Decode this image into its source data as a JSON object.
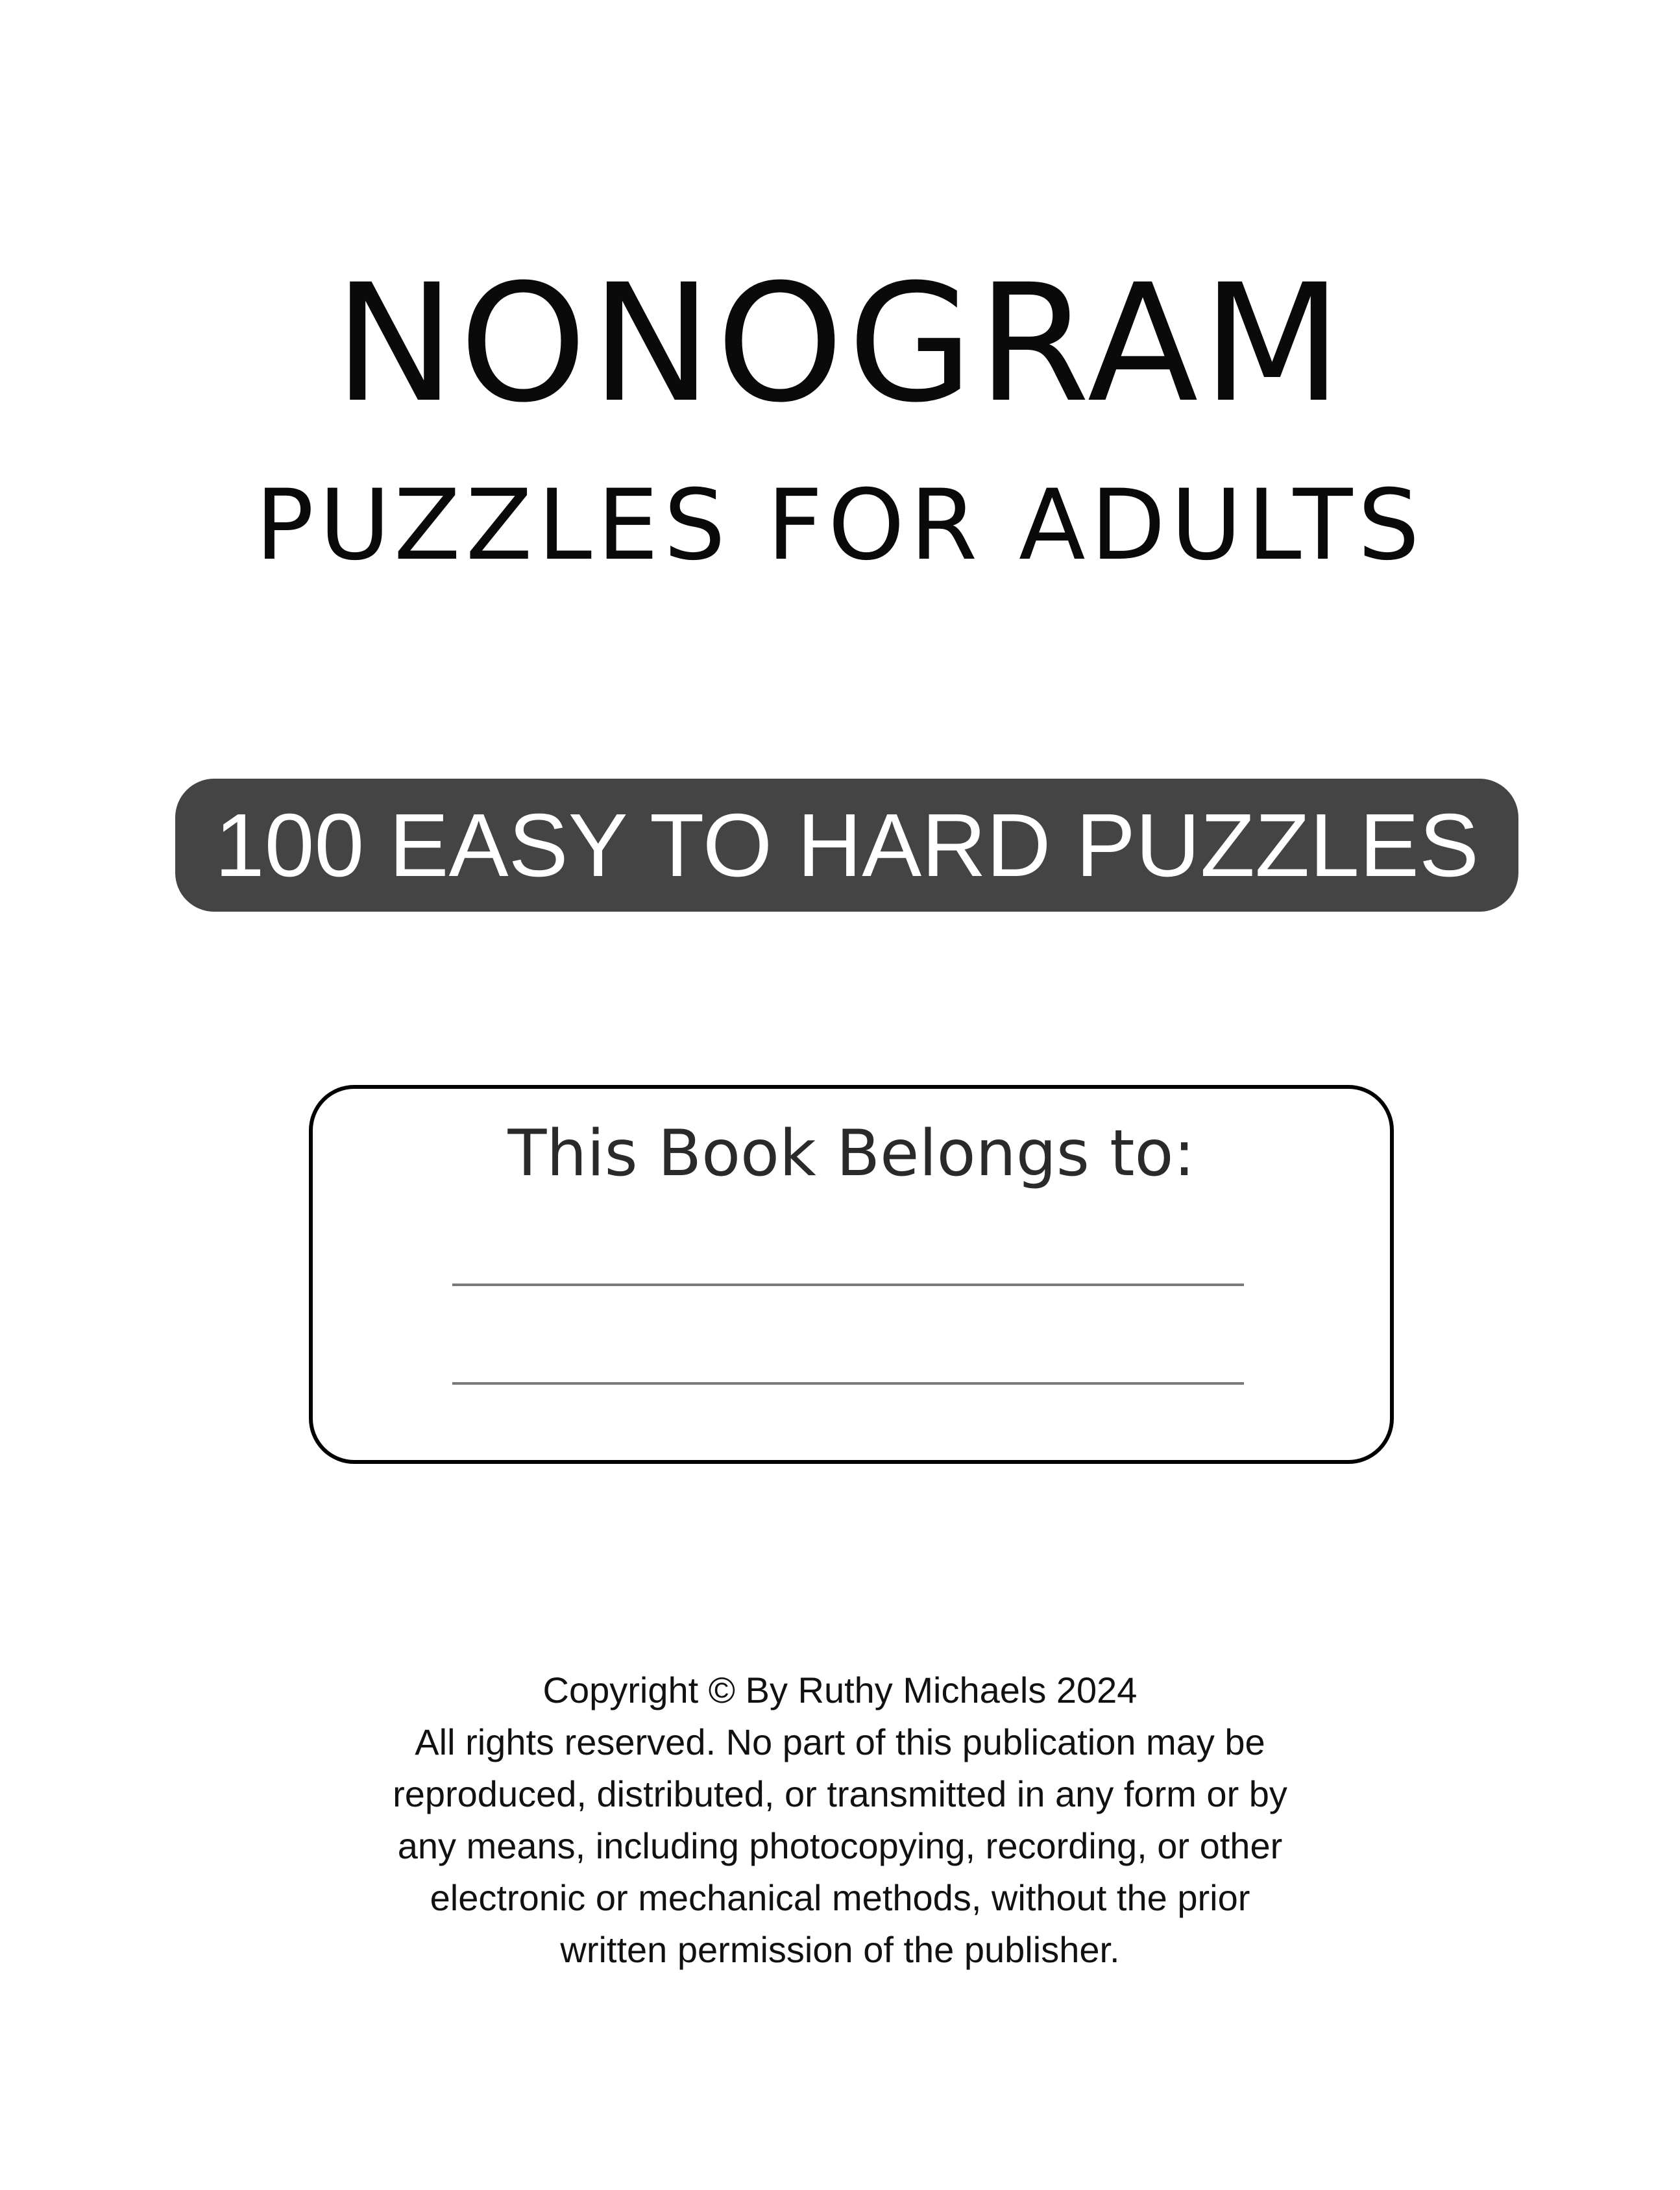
{
  "cover": {
    "title": "NONOGRAM",
    "subtitle": "PUZZLES FOR ADULTS",
    "banner": "100 EASY TO HARD PUZZLES",
    "owner_label": "This Book Belongs to:"
  },
  "copyright": {
    "lines": [
      "Copyright © By Ruthy Michaels 2024",
      "All rights reserved. No part of this publication may be",
      "reproduced, distributed, or transmitted in any form or by",
      "any means, including photocopying, recording, or other",
      "electronic or mechanical methods, without the prior",
      "written permission of the publisher."
    ]
  },
  "colors": {
    "banner_background": "#444444",
    "banner_text": "#ffffff",
    "text": "#000000",
    "writing_line": "#7a7a7a"
  }
}
